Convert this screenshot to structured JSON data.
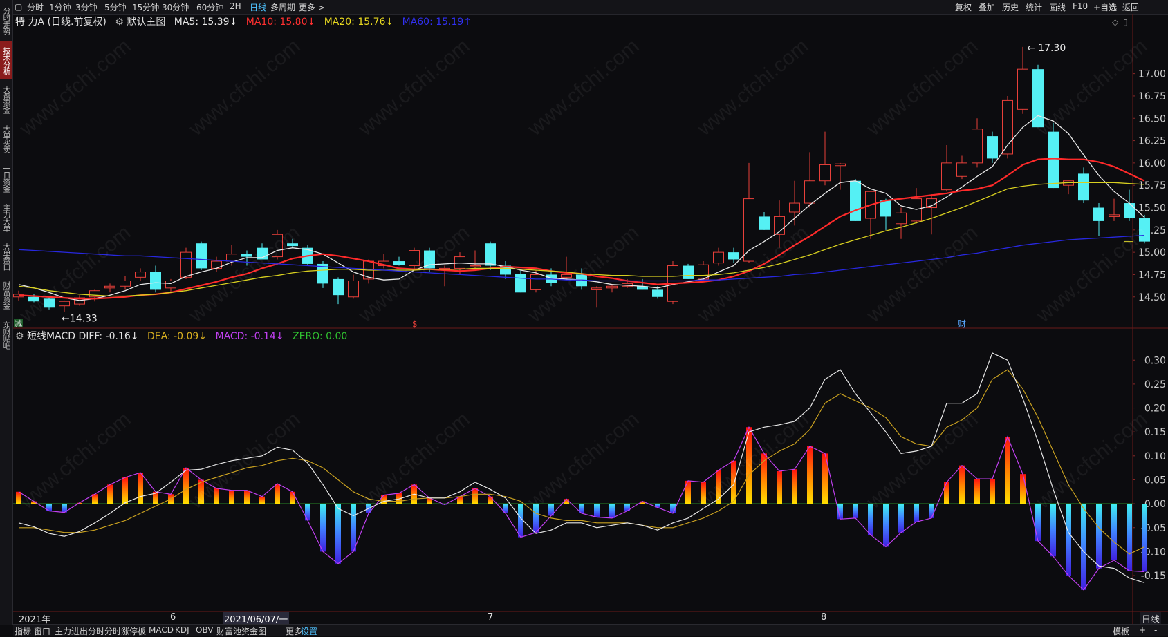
{
  "left_tabs": [
    {
      "label": "分时走势",
      "active": false
    },
    {
      "label": "技术分析",
      "active": true
    },
    {
      "label": "大盘资金",
      "active": false
    },
    {
      "label": "大单买卖",
      "active": false
    },
    {
      "label": "一日资金",
      "active": false
    },
    {
      "label": "主力大单",
      "active": false
    },
    {
      "label": "大单盘口",
      "active": false
    },
    {
      "label": "财富资金",
      "active": false
    },
    {
      "label": "东财贴吧",
      "active": false
    }
  ],
  "period_tabs": [
    "分时",
    "1分钟",
    "3分钟",
    "5分钟",
    "15分钟",
    "30分钟",
    "60分钟",
    "2H",
    "日线",
    "多周期",
    "更多 >"
  ],
  "active_period": "日线",
  "right_tools": [
    "复权",
    "叠加",
    "历史",
    "统计",
    "画线",
    "F10",
    "+自选",
    "返回"
  ],
  "main_legend": {
    "title": "特 力A (日线.前复权)",
    "indicator": "默认主图",
    "ma5": "MA5: 15.39↓",
    "ma10": "MA10: 15.80↓",
    "ma20": "MA20: 15.76↓",
    "ma60": "MA60: 15.19↑"
  },
  "macd_legend": {
    "title": "短线MACD",
    "diff": "DIFF: -0.16↓",
    "dea": "DEA: -0.09↓",
    "macd": "MACD: -0.14↓",
    "zero": "ZERO: 0.00"
  },
  "annotations": {
    "high": "17.30",
    "low": "←14.33",
    "marker_s": "$",
    "marker_cai": "财",
    "marker_jian": "减"
  },
  "date_labels": {
    "year": "2021年",
    "m6": "6",
    "cursor_date": "2021/06/07/一",
    "m7": "7",
    "m8": "8",
    "period": "日线"
  },
  "bottom_tabs": [
    "指标",
    "窗口",
    "主力进出分时",
    "分时涨停板",
    "MACD",
    "KDJ",
    "OBV",
    "财富池资金图",
    "更多",
    "设置"
  ],
  "bottom_right": {
    "template": "模板",
    "plus": "+",
    "minus": "-"
  },
  "watermark": "www.cfchi.com",
  "colors": {
    "up": "#e8403a",
    "down": "#55f0f4",
    "ma5": "#e8e8e8",
    "ma10": "#ff2a2a",
    "ma20": "#d8d020",
    "ma60": "#2828e0",
    "dea": "#c8a020",
    "macd_line": "#c040f0",
    "zero": "#30b030"
  },
  "chart_data": [
    {
      "type": "candlestick",
      "title": "特 力A (日线.前复权)",
      "y_ticks": [
        14.5,
        14.75,
        15.0,
        15.25,
        15.5,
        15.75,
        16.0,
        16.25,
        16.5,
        16.75,
        17.0
      ],
      "ylim": [
        14.15,
        17.5
      ],
      "x_labels": [
        "2021年",
        "6",
        "7",
        "8"
      ],
      "candles": [
        [
          14.5,
          14.57,
          14.46,
          14.53
        ],
        [
          14.5,
          14.53,
          14.44,
          14.45
        ],
        [
          14.48,
          14.5,
          14.36,
          14.38
        ],
        [
          14.4,
          14.46,
          14.33,
          14.45
        ],
        [
          14.42,
          14.52,
          14.4,
          14.49
        ],
        [
          14.5,
          14.58,
          14.45,
          14.57
        ],
        [
          14.6,
          14.65,
          14.55,
          14.62
        ],
        [
          14.62,
          14.73,
          14.58,
          14.68
        ],
        [
          14.72,
          14.82,
          14.68,
          14.78
        ],
        [
          14.78,
          14.85,
          14.55,
          14.58
        ],
        [
          14.6,
          14.7,
          14.55,
          14.68
        ],
        [
          14.72,
          15.05,
          14.7,
          15.0
        ],
        [
          15.1,
          15.12,
          14.8,
          14.82
        ],
        [
          14.82,
          14.95,
          14.78,
          14.9
        ],
        [
          14.9,
          15.08,
          14.85,
          14.98
        ],
        [
          14.98,
          15.02,
          14.85,
          14.95
        ],
        [
          15.05,
          15.1,
          14.92,
          14.92
        ],
        [
          14.95,
          15.25,
          14.92,
          15.2
        ],
        [
          15.1,
          15.15,
          15.05,
          15.07
        ],
        [
          15.05,
          15.08,
          14.85,
          14.87
        ],
        [
          14.87,
          14.9,
          14.6,
          14.65
        ],
        [
          14.7,
          14.72,
          14.42,
          14.52
        ],
        [
          14.5,
          14.75,
          14.48,
          14.68
        ],
        [
          14.7,
          14.92,
          14.65,
          14.9
        ],
        [
          14.85,
          14.98,
          14.82,
          14.9
        ],
        [
          14.9,
          14.95,
          14.85,
          14.86
        ],
        [
          14.85,
          15.05,
          14.8,
          15.02
        ],
        [
          15.02,
          15.05,
          14.78,
          14.82
        ],
        [
          14.8,
          14.85,
          14.62,
          14.82
        ],
        [
          14.82,
          15.0,
          14.75,
          14.95
        ],
        [
          14.85,
          15.02,
          14.8,
          14.85
        ],
        [
          15.1,
          15.12,
          14.8,
          14.85
        ],
        [
          14.85,
          14.9,
          14.7,
          14.75
        ],
        [
          14.76,
          14.8,
          14.55,
          14.55
        ],
        [
          14.58,
          14.8,
          14.55,
          14.75
        ],
        [
          14.75,
          14.82,
          14.62,
          14.66
        ],
        [
          14.72,
          14.95,
          14.7,
          14.75
        ],
        [
          14.75,
          14.82,
          14.58,
          14.62
        ],
        [
          14.58,
          14.62,
          14.38,
          14.6
        ],
        [
          14.6,
          14.64,
          14.55,
          14.62
        ],
        [
          14.62,
          14.7,
          14.6,
          14.65
        ],
        [
          14.62,
          14.7,
          14.58,
          14.58
        ],
        [
          14.58,
          14.62,
          14.48,
          14.5
        ],
        [
          14.45,
          14.9,
          14.42,
          14.85
        ],
        [
          14.85,
          14.87,
          14.7,
          14.7
        ],
        [
          14.7,
          14.9,
          14.68,
          14.86
        ],
        [
          14.88,
          15.05,
          14.85,
          15.0
        ],
        [
          15.0,
          15.05,
          14.88,
          14.92
        ],
        [
          14.9,
          16.0,
          14.88,
          15.6
        ],
        [
          15.4,
          15.45,
          15.25,
          15.25
        ],
        [
          15.2,
          15.58,
          15.05,
          15.4
        ],
        [
          15.45,
          15.8,
          15.3,
          15.55
        ],
        [
          15.55,
          16.12,
          15.5,
          15.8
        ],
        [
          15.8,
          16.35,
          15.75,
          15.98
        ],
        [
          15.97,
          16.0,
          15.7,
          15.99
        ],
        [
          15.8,
          15.82,
          15.35,
          15.35
        ],
        [
          15.38,
          15.68,
          15.15,
          15.68
        ],
        [
          15.58,
          15.6,
          15.25,
          15.4
        ],
        [
          15.32,
          15.5,
          15.15,
          15.44
        ],
        [
          15.35,
          15.72,
          15.32,
          15.6
        ],
        [
          15.5,
          15.65,
          15.2,
          15.6
        ],
        [
          15.7,
          16.2,
          15.68,
          16.0
        ],
        [
          15.85,
          16.08,
          15.82,
          16.0
        ],
        [
          16.0,
          16.5,
          15.95,
          16.38
        ],
        [
          16.3,
          16.35,
          16.0,
          16.05
        ],
        [
          16.1,
          16.75,
          16.05,
          16.7
        ],
        [
          16.6,
          17.3,
          16.55,
          17.05
        ],
        [
          17.05,
          17.1,
          16.4,
          16.4
        ],
        [
          16.35,
          16.45,
          15.72,
          15.72
        ],
        [
          15.75,
          15.8,
          15.65,
          15.8
        ],
        [
          15.88,
          15.95,
          15.55,
          15.58
        ],
        [
          15.5,
          15.55,
          15.18,
          15.35
        ],
        [
          15.4,
          15.6,
          15.35,
          15.42
        ],
        [
          15.55,
          15.7,
          15.35,
          15.38
        ],
        [
          15.38,
          15.42,
          15.1,
          15.12
        ]
      ],
      "series": [
        {
          "name": "MA5",
          "values": [
            14.64,
            14.6,
            14.55,
            14.49,
            14.46,
            14.48,
            14.52,
            14.57,
            14.64,
            14.66,
            14.65,
            14.73,
            14.78,
            14.82,
            14.89,
            14.94,
            14.94,
            15.02,
            15.05,
            15.03,
            14.98,
            14.88,
            14.78,
            14.72,
            14.69,
            14.7,
            14.8,
            14.86,
            14.87,
            14.88,
            14.87,
            14.87,
            14.84,
            14.8,
            14.77,
            14.71,
            14.7,
            14.69,
            14.67,
            14.64,
            14.63,
            14.62,
            14.6,
            14.64,
            14.67,
            14.7,
            14.78,
            14.85,
            15.02,
            15.12,
            15.23,
            15.38,
            15.53,
            15.66,
            15.78,
            15.8,
            15.71,
            15.66,
            15.52,
            15.48,
            15.52,
            15.62,
            15.73,
            15.85,
            15.96,
            16.2,
            16.4,
            16.53,
            16.47,
            16.33,
            16.09,
            15.86,
            15.68,
            15.55,
            15.39
          ]
        },
        {
          "name": "MA10",
          "values": [
            14.52,
            14.51,
            14.5,
            14.49,
            14.48,
            14.48,
            14.49,
            14.5,
            14.52,
            14.53,
            14.55,
            14.59,
            14.63,
            14.67,
            14.72,
            14.76,
            14.82,
            14.87,
            14.93,
            14.96,
            14.98,
            14.96,
            14.93,
            14.9,
            14.86,
            14.82,
            14.81,
            14.81,
            14.8,
            14.79,
            14.8,
            14.82,
            14.84,
            14.83,
            14.82,
            14.79,
            14.77,
            14.76,
            14.73,
            14.71,
            14.68,
            14.66,
            14.64,
            14.65,
            14.66,
            14.67,
            14.69,
            14.73,
            14.79,
            14.87,
            14.97,
            15.08,
            15.18,
            15.29,
            15.4,
            15.47,
            15.53,
            15.58,
            15.6,
            15.62,
            15.64,
            15.66,
            15.69,
            15.71,
            15.75,
            15.86,
            15.98,
            16.04,
            16.05,
            16.04,
            16.04,
            16.01,
            15.96,
            15.88,
            15.8
          ]
        },
        {
          "name": "MA20",
          "values": [
            14.62,
            14.6,
            14.57,
            14.55,
            14.53,
            14.52,
            14.51,
            14.51,
            14.52,
            14.53,
            14.55,
            14.57,
            14.6,
            14.63,
            14.66,
            14.69,
            14.72,
            14.74,
            14.77,
            14.79,
            14.8,
            14.81,
            14.81,
            14.8,
            14.8,
            14.8,
            14.8,
            14.81,
            14.81,
            14.81,
            14.82,
            14.82,
            14.82,
            14.81,
            14.8,
            14.79,
            14.78,
            14.76,
            14.75,
            14.74,
            14.74,
            14.73,
            14.73,
            14.73,
            14.74,
            14.74,
            14.75,
            14.77,
            14.8,
            14.83,
            14.87,
            14.92,
            14.97,
            15.03,
            15.09,
            15.14,
            15.19,
            15.24,
            15.28,
            15.33,
            15.38,
            15.44,
            15.5,
            15.57,
            15.64,
            15.71,
            15.74,
            15.76,
            15.77,
            15.78,
            15.78,
            15.78,
            15.78,
            15.77,
            15.76
          ]
        },
        {
          "name": "MA60",
          "values": [
            15.03,
            15.02,
            15.01,
            15.0,
            14.99,
            14.98,
            14.97,
            14.96,
            14.96,
            14.95,
            14.94,
            14.93,
            14.92,
            14.91,
            14.9,
            14.89,
            14.88,
            14.87,
            14.86,
            14.85,
            14.84,
            14.83,
            14.82,
            14.81,
            14.8,
            14.79,
            14.78,
            14.77,
            14.76,
            14.75,
            14.74,
            14.73,
            14.72,
            14.71,
            14.7,
            14.7,
            14.69,
            14.69,
            14.68,
            14.68,
            14.68,
            14.68,
            14.68,
            14.68,
            14.68,
            14.69,
            14.69,
            14.7,
            14.71,
            14.72,
            14.73,
            14.75,
            14.76,
            14.78,
            14.8,
            14.82,
            14.84,
            14.86,
            14.88,
            14.9,
            14.92,
            14.94,
            14.97,
            14.99,
            15.02,
            15.05,
            15.08,
            15.1,
            15.12,
            15.14,
            15.15,
            15.16,
            15.17,
            15.18,
            15.19
          ]
        }
      ]
    },
    {
      "type": "macd",
      "title": "短线MACD",
      "y_ticks": [
        -0.15,
        -0.1,
        -0.05,
        0.0,
        0.05,
        0.1,
        0.15,
        0.2,
        0.25,
        0.3
      ],
      "ylim": [
        -0.225,
        0.335
      ],
      "series": [
        {
          "name": "DIFF",
          "values": [
            -0.04,
            -0.048,
            -0.062,
            -0.068,
            -0.058,
            -0.04,
            -0.02,
            0.002,
            0.015,
            0.022,
            0.045,
            0.07,
            0.072,
            0.082,
            0.09,
            0.095,
            0.1,
            0.118,
            0.112,
            0.085,
            0.04,
            -0.01,
            -0.025,
            -0.01,
            0.005,
            0.01,
            0.02,
            0.012,
            0.012,
            0.025,
            0.045,
            0.03,
            0.012,
            -0.03,
            -0.062,
            -0.055,
            -0.04,
            -0.04,
            -0.05,
            -0.045,
            -0.04,
            -0.045,
            -0.055,
            -0.04,
            -0.03,
            -0.01,
            0.01,
            0.04,
            0.15,
            0.16,
            0.165,
            0.172,
            0.2,
            0.26,
            0.28,
            0.23,
            0.19,
            0.15,
            0.105,
            0.11,
            0.12,
            0.21,
            0.21,
            0.23,
            0.315,
            0.3,
            0.22,
            0.13,
            0.03,
            -0.06,
            -0.1,
            -0.13,
            -0.135,
            -0.155,
            -0.165
          ]
        },
        {
          "name": "DEA",
          "values": [
            -0.05,
            -0.05,
            -0.055,
            -0.06,
            -0.06,
            -0.055,
            -0.045,
            -0.035,
            -0.02,
            -0.005,
            0.01,
            0.03,
            0.045,
            0.055,
            0.065,
            0.075,
            0.08,
            0.09,
            0.095,
            0.09,
            0.075,
            0.05,
            0.025,
            0.01,
            0.005,
            0.005,
            0.01,
            0.012,
            0.012,
            0.015,
            0.02,
            0.02,
            0.015,
            0.005,
            -0.02,
            -0.03,
            -0.035,
            -0.035,
            -0.04,
            -0.04,
            -0.04,
            -0.045,
            -0.05,
            -0.05,
            -0.04,
            -0.03,
            -0.015,
            0.005,
            0.06,
            0.09,
            0.11,
            0.125,
            0.155,
            0.21,
            0.23,
            0.215,
            0.2,
            0.18,
            0.14,
            0.125,
            0.12,
            0.16,
            0.175,
            0.2,
            0.26,
            0.28,
            0.24,
            0.18,
            0.11,
            0.04,
            -0.01,
            -0.05,
            -0.08,
            -0.105,
            -0.09
          ]
        },
        {
          "name": "MACD",
          "values": [
            0.025,
            0.005,
            -0.015,
            -0.018,
            0.002,
            0.02,
            0.04,
            0.055,
            0.065,
            0.025,
            0.02,
            0.075,
            0.05,
            0.032,
            0.028,
            0.028,
            0.015,
            0.042,
            0.025,
            -0.035,
            -0.1,
            -0.125,
            -0.1,
            -0.02,
            0.018,
            0.022,
            0.04,
            0.012,
            -0.002,
            0.015,
            0.032,
            0.015,
            -0.02,
            -0.07,
            -0.06,
            -0.025,
            0.01,
            -0.02,
            -0.028,
            -0.03,
            -0.015,
            0.005,
            -0.008,
            -0.02,
            0.048,
            0.045,
            0.07,
            0.09,
            0.16,
            0.105,
            0.068,
            0.072,
            0.12,
            0.105,
            -0.032,
            -0.03,
            -0.065,
            -0.09,
            -0.06,
            -0.038,
            -0.03,
            0.045,
            0.08,
            0.052,
            0.052,
            0.14,
            0.062,
            -0.078,
            -0.11,
            -0.15,
            -0.18,
            -0.135,
            -0.118,
            -0.14,
            -0.142
          ]
        }
      ]
    }
  ]
}
